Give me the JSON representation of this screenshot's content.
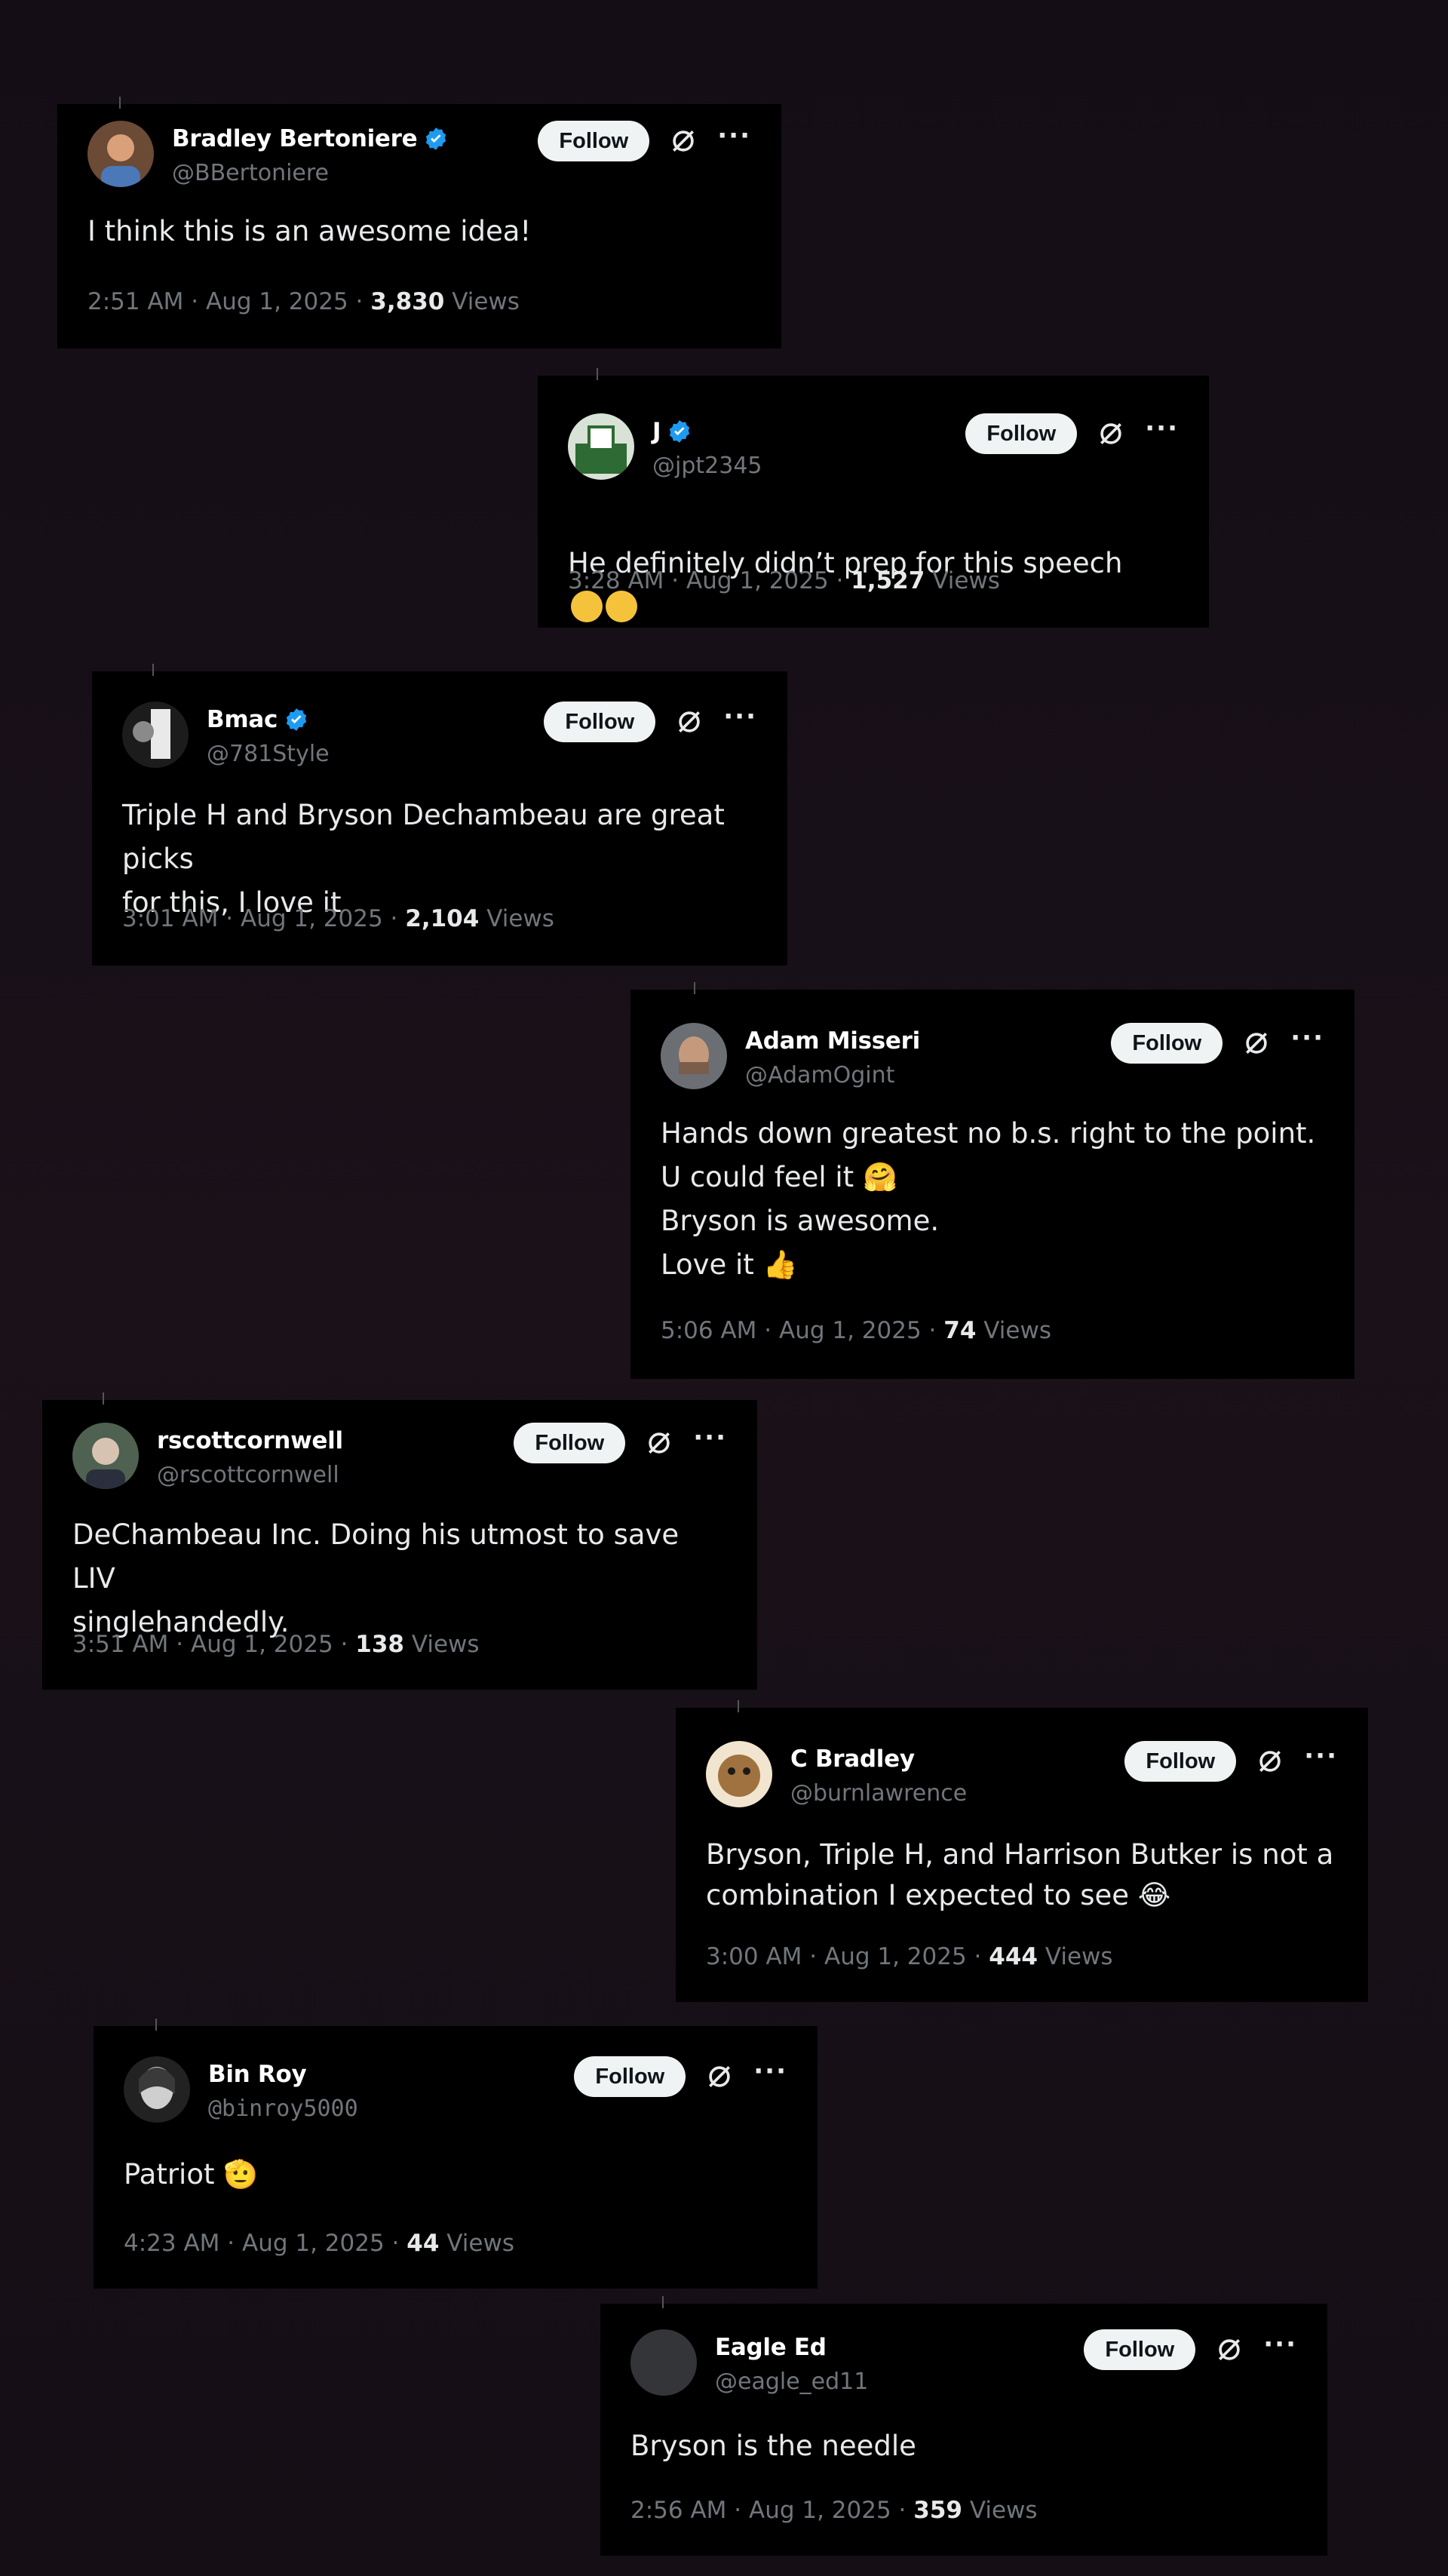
{
  "follow_label": "Follow",
  "views_label": "Views",
  "tweets": [
    {
      "name": "Bradley Bertoniere",
      "handle": "@BBertoniere",
      "verified": true,
      "text": "I think this is an awesome idea!",
      "time": "2:51 AM · Aug 1, 2025 · ",
      "views": "3,830"
    },
    {
      "name": "J",
      "handle": "@jpt2345",
      "verified": true,
      "text": "He definitely didn’t prep for this speech",
      "emoji": [
        "sweat-smile-emoji",
        "joy-emoji"
      ],
      "time": "3:28 AM · Aug 1, 2025 · ",
      "views": "1,527"
    },
    {
      "name": "Bmac",
      "handle": "@781Style",
      "verified": true,
      "text": "Triple H and Bryson Dechambeau are great picks\nfor this, I love it",
      "time": "3:01 AM · Aug 1, 2025 · ",
      "views": "2,104"
    },
    {
      "name": "Adam Misseri",
      "handle": "@AdamOgint",
      "verified": false,
      "text": "Hands down greatest no b.s. right to the point.\nU could feel it 🤗\nBryson is awesome.\nLove it 👍",
      "time": "5:06 AM · Aug 1, 2025 · ",
      "views": "74"
    },
    {
      "name": "rscottcornwell",
      "handle": "@rscottcornwell",
      "verified": false,
      "text": "DeChambeau Inc. Doing his utmost to save LIV\nsinglehandedly.",
      "time": "3:51 AM · Aug 1, 2025 · ",
      "views": "138"
    },
    {
      "name": "C Bradley",
      "handle": "@burnlawrence",
      "verified": false,
      "text": "Bryson, Triple H, and Harrison Butker is not a\ncombination I expected to see 😂",
      "time": "3:00 AM · Aug 1, 2025 · ",
      "views": "444"
    },
    {
      "name": "Bin Roy",
      "handle": "@binroy5000",
      "verified": false,
      "text": "Patriot 🫡",
      "time": "4:23 AM · Aug 1, 2025 · ",
      "views": "44"
    },
    {
      "name": "Eagle Ed",
      "handle": "@eagle_ed11",
      "verified": false,
      "text": "Bryson is the needle",
      "time": "2:56 AM · Aug 1, 2025 · ",
      "views": "359"
    }
  ],
  "colors": {
    "background": "#160f17",
    "card": "#000000",
    "text": "#e7e9ea",
    "muted": "#71767b",
    "verified": "#1d9bf0",
    "follow_bg": "#eff3f4"
  }
}
